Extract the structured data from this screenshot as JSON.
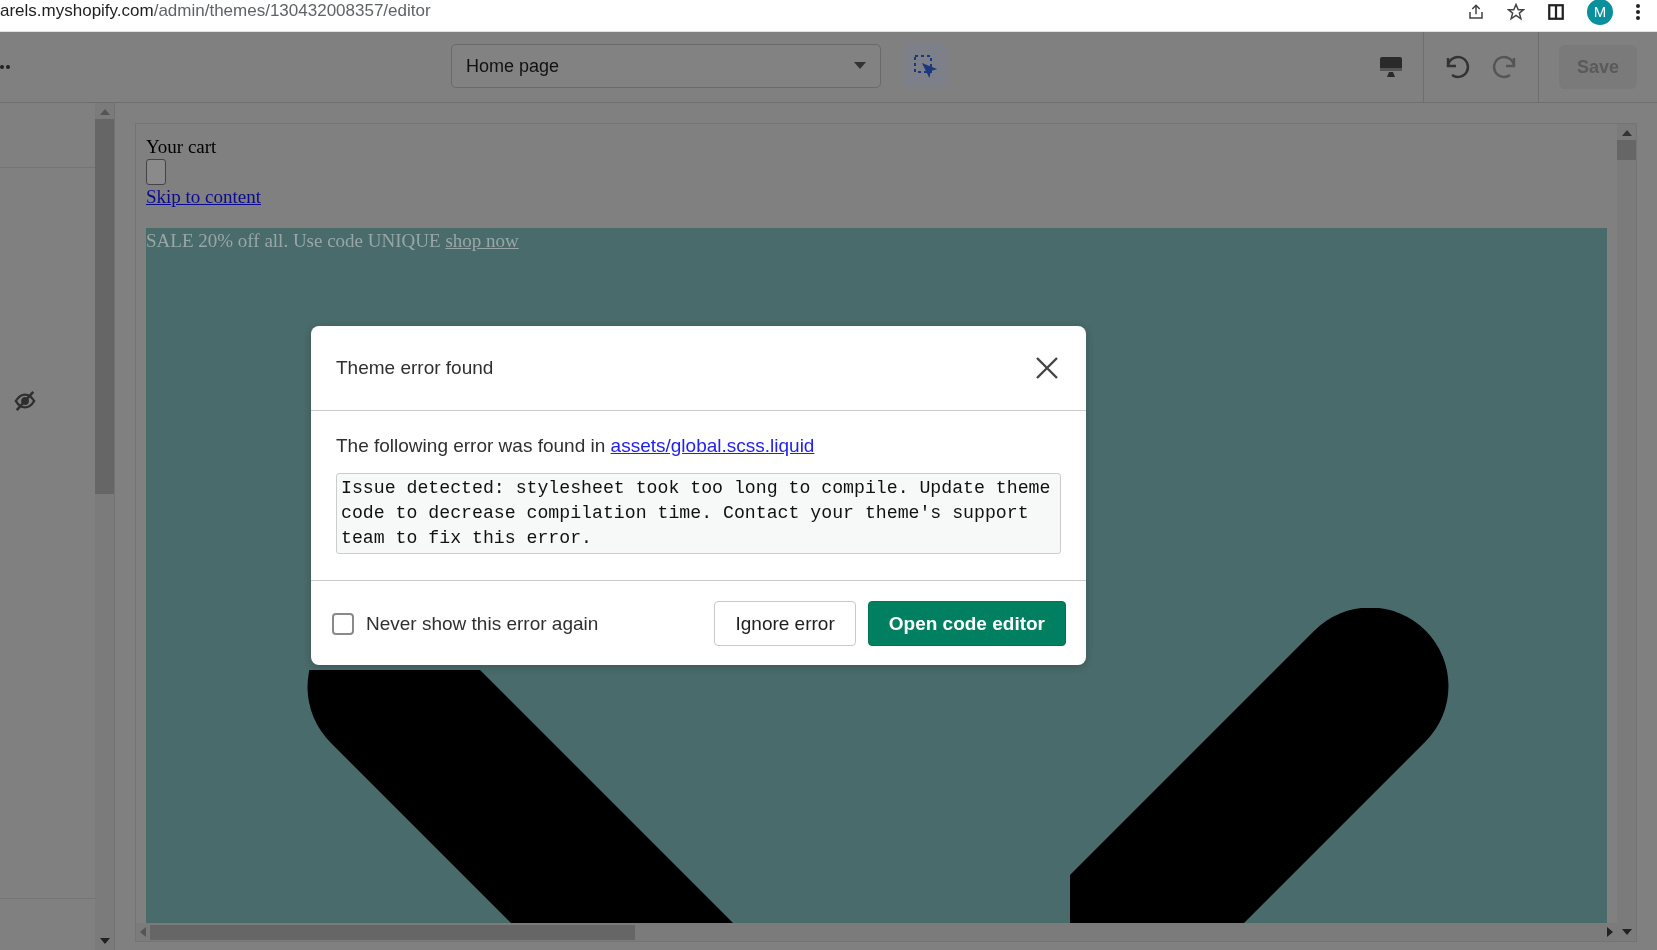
{
  "browser": {
    "url_host": "arels.myshopify.com",
    "url_path": "/admin/themes/130432008357/editor",
    "profile_initial": "M"
  },
  "toolbar": {
    "page_select": "Home page",
    "save_button": {
      "label": "Save",
      "disabled": true
    }
  },
  "preview": {
    "cart_title": "Your cart",
    "skip_link": "Skip to content",
    "announcement": {
      "text": "SALE 20% off all. Use code UNIQUE",
      "link": "shop now"
    }
  },
  "dialog": {
    "title": "Theme error found",
    "intro": "The following error was found in",
    "file_link": "assets/global.scss.liquid",
    "message": "Issue detected: stylesheet took too long to compile. Update theme code to decrease compilation time. Contact your theme's support team to fix this error.",
    "never_show": {
      "label": "Never show this error again",
      "checked": false
    },
    "buttons": [
      {
        "label": "Ignore error",
        "kind": "secondary"
      },
      {
        "label": "Open code editor",
        "kind": "primary"
      }
    ]
  }
}
